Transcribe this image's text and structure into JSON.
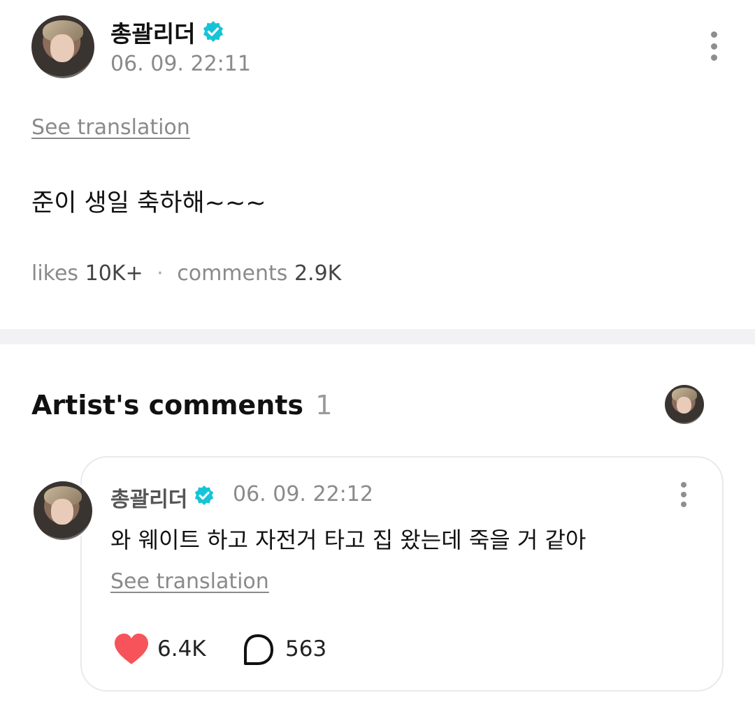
{
  "post": {
    "author": "총괄리더",
    "timestamp": "06. 09. 22:11",
    "see_translation": "See translation",
    "body": "준이 생일 축하해~~~",
    "likes_label": "likes",
    "likes_count": "10K+",
    "separator": "·",
    "comments_label": "comments",
    "comments_count": "2.9K"
  },
  "artist_comments": {
    "title": "Artist's comments",
    "count": "1"
  },
  "comment": {
    "author": "총괄리더",
    "timestamp": "06. 09. 22:12",
    "text": "와 웨이트 하고 자전거 타고 집 왔는데 죽을 거 같아",
    "see_translation": "See translation",
    "like_count": "6.4K",
    "reply_count": "563"
  },
  "icons": {
    "verified": "verified-badge-icon",
    "more": "more-vertical-icon",
    "heart": "heart-icon",
    "speech": "speech-bubble-icon"
  },
  "colors": {
    "verified": "#17c3d6",
    "heart": "#f7535a",
    "divider": "#f2f2f4",
    "muted_text": "#7d7d7d"
  }
}
